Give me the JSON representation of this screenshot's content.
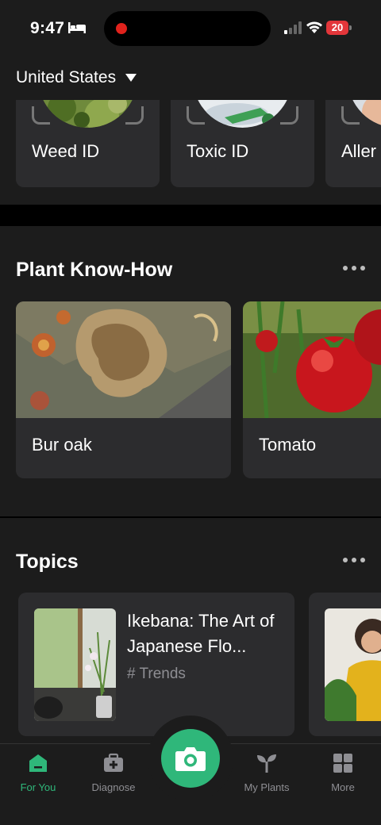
{
  "status_bar": {
    "time": "9:47",
    "battery": "20",
    "colors": {
      "battery": "#e3363a",
      "recording": "#e0221c"
    }
  },
  "header": {
    "country": "United States"
  },
  "identify": {
    "items": [
      {
        "label": "Weed ID",
        "icon": "weed-photo"
      },
      {
        "label": "Toxic ID",
        "icon": "toxic-photo"
      },
      {
        "label": "Aller",
        "icon": "allergy-photo"
      }
    ]
  },
  "know_how": {
    "title": "Plant Know-How",
    "items": [
      {
        "label": "Bur oak",
        "image": "bur-oak-leaf-pattern"
      },
      {
        "label": "Tomato",
        "image": "tomato-photo"
      }
    ]
  },
  "topics": {
    "title": "Topics",
    "items": [
      {
        "title": "Ikebana: The Art of Japanese Flo...",
        "tag": "# Trends",
        "image": "ikebana-photo"
      },
      {
        "title": "",
        "tag": "",
        "image": "gardening-woman-photo"
      }
    ]
  },
  "tab_bar": {
    "accent": "#2fb77a",
    "tabs": [
      {
        "label": "For You",
        "icon": "home-icon",
        "active": true
      },
      {
        "label": "Diagnose",
        "icon": "medkit-icon",
        "active": false
      },
      {
        "label": "My Plants",
        "icon": "sprout-icon",
        "active": false
      },
      {
        "label": "More",
        "icon": "grid-icon",
        "active": false
      }
    ],
    "camera": "camera-icon"
  }
}
